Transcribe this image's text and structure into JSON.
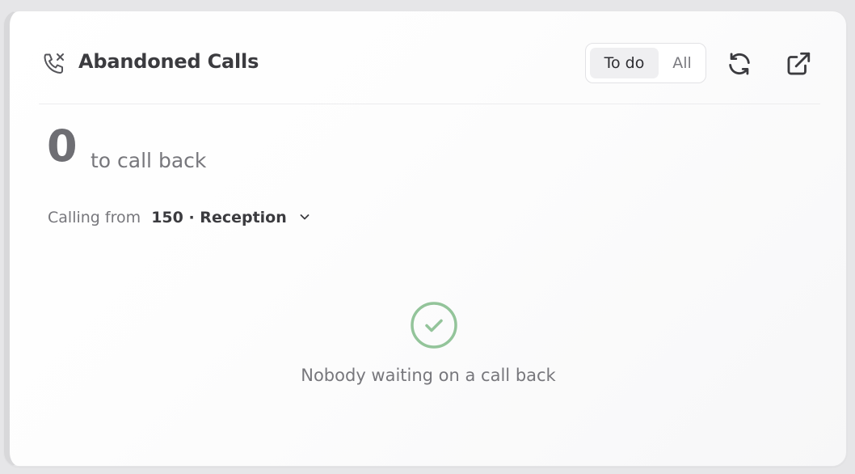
{
  "widget": {
    "title": "Abandoned Calls",
    "title_icon": "phone-missed-icon",
    "filter": {
      "options": [
        "To do",
        "All"
      ],
      "selected": "To do"
    },
    "actions": {
      "refresh_icon": "refresh-icon",
      "open_icon": "external-link-icon"
    }
  },
  "summary": {
    "count": "0",
    "count_label": "to call back"
  },
  "calling_from": {
    "label": "Calling from",
    "value": "150 · Reception",
    "icon": "chevron-down-icon"
  },
  "empty_state": {
    "icon": "check-circle-icon",
    "message": "Nobody waiting on a call back"
  },
  "colors": {
    "success": "#93c49a",
    "text_primary": "#3b3b3f",
    "text_muted": "#77777c"
  }
}
